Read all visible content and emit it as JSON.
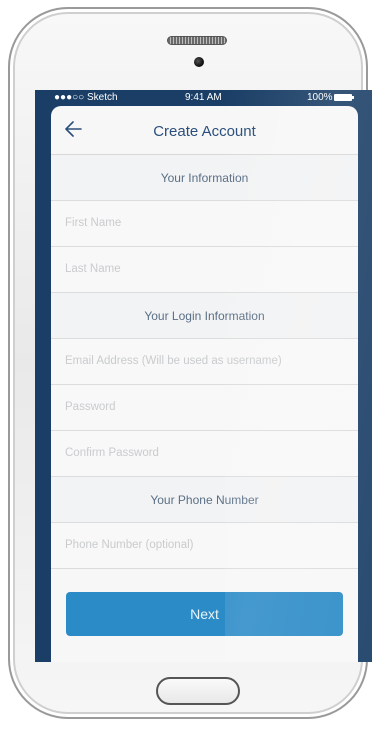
{
  "status_bar": {
    "carrier": "●●●○○ Sketch",
    "time": "9:41 AM",
    "battery": "100%"
  },
  "nav": {
    "title": "Create Account",
    "back_icon": "arrow-left-icon"
  },
  "sections": {
    "info": "Your Information",
    "login": "Your Login Information",
    "phone": "Your Phone Number"
  },
  "fields": {
    "first_name": {
      "placeholder": "First Name",
      "value": ""
    },
    "last_name": {
      "placeholder": "Last Name",
      "value": ""
    },
    "email": {
      "placeholder": "Email Address (Will be used as username)",
      "value": ""
    },
    "password": {
      "placeholder": "Password",
      "value": ""
    },
    "confirm_password": {
      "placeholder": "Confirm Password",
      "value": ""
    },
    "phone": {
      "placeholder": "Phone Number (optional)",
      "value": ""
    }
  },
  "actions": {
    "next_label": "Next"
  },
  "colors": {
    "screen_bg": "#1a3e66",
    "accent": "#2b8bc7",
    "title": "#2b4f7a"
  }
}
